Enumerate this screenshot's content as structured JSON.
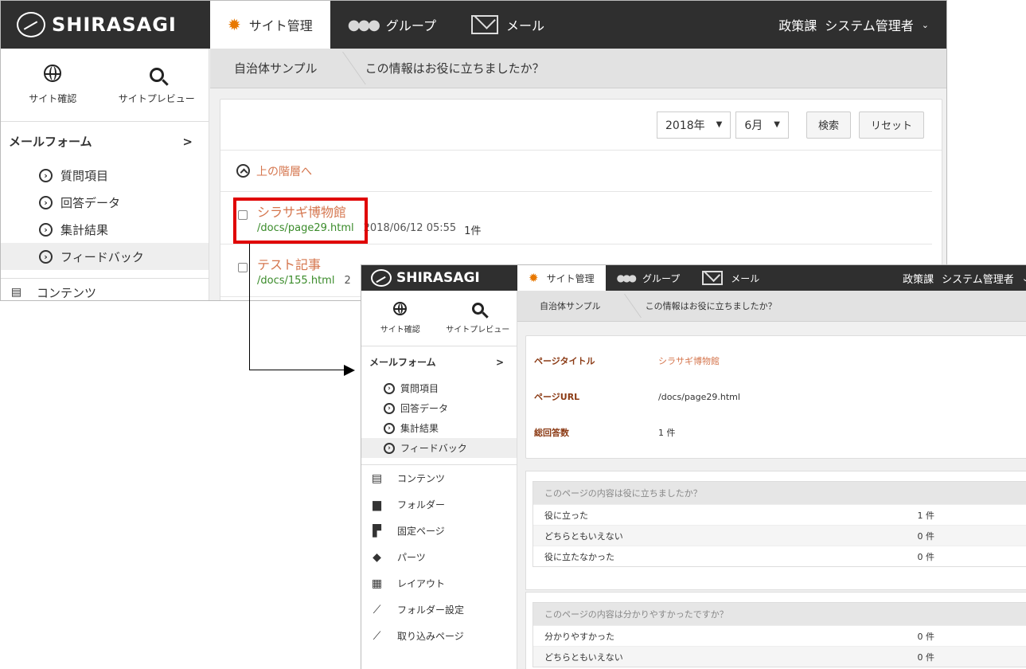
{
  "app": {
    "logo_text": "SHIRASAGI",
    "user_group": "政策課",
    "user_name": "システム管理者"
  },
  "nav": {
    "tabs": [
      {
        "label": "サイト管理",
        "icon": "gear-icon",
        "active": true
      },
      {
        "label": "グループ",
        "icon": "group-icon"
      },
      {
        "label": "メール",
        "icon": "mail-icon"
      }
    ]
  },
  "sidebar": {
    "site_check": "サイト確認",
    "site_preview": "サイトプレビュー",
    "menu_title": "メールフォーム",
    "menu_items": [
      "質問項目",
      "回答データ",
      "集計結果",
      "フィードバック"
    ],
    "contents": [
      "コンテンツ",
      "フォルダー",
      "固定ページ",
      "パーツ",
      "レイアウト",
      "フォルダー設定",
      "取り込みページ"
    ]
  },
  "breadcrumb": {
    "items": [
      "自治体サンプル",
      "この情報はお役に立ちましたか？"
    ]
  },
  "list": {
    "year": "2018年",
    "month": "6月",
    "search_label": "検索",
    "reset_label": "リセット",
    "up_link": "上の階層へ",
    "rows": [
      {
        "title": "シラサギ博物館",
        "url": "/docs/page29.html",
        "date": "2018/06/12 05:55",
        "count": "1件"
      },
      {
        "title": "テスト記事",
        "url": "/docs/155.html",
        "date": "2",
        "count": ""
      }
    ]
  },
  "detail": {
    "title_label": "ページタイトル",
    "title_value": "シラサギ博物館",
    "url_label": "ページURL",
    "url_value": "/docs/page29.html",
    "total_label": "総回答数",
    "total_value": "1 件",
    "feedback": [
      {
        "question": "このページの内容は役に立ちましたか？",
        "answers": [
          {
            "label": "役に立った",
            "count": "1 件"
          },
          {
            "label": "どちらともいえない",
            "count": "0 件"
          },
          {
            "label": "役に立たなかった",
            "count": "0 件"
          }
        ]
      },
      {
        "question": "このページの内容は分かりやすかったですか？",
        "answers": [
          {
            "label": "分かりやすかった",
            "count": "0 件"
          },
          {
            "label": "どちらともいえない",
            "count": "0 件"
          }
        ]
      }
    ]
  },
  "colors": {
    "header_bg": "#2f2f2f",
    "accent_orange": "#e87800",
    "link_color": "#d5764e",
    "url_green": "#3a8b2a",
    "highlight_red": "#e00000"
  }
}
